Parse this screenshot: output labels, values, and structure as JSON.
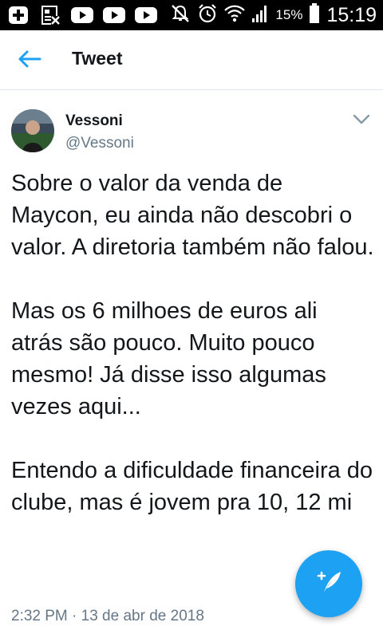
{
  "status_bar": {
    "left_icons": [
      "add-box-icon",
      "image-icon",
      "youtube-icon",
      "youtube-icon",
      "youtube-icon"
    ],
    "right_icons": [
      "notifications-off-icon",
      "alarm-icon",
      "wifi-icon",
      "signal-icon",
      "battery-icon"
    ],
    "battery": "15%",
    "time": "15:19"
  },
  "app_bar": {
    "back_icon": "arrow-left-icon",
    "title": "Tweet"
  },
  "tweet": {
    "author_name": "Vessoni",
    "author_handle": "@Vessoni",
    "paragraphs": [
      "Sobre o valor da venda de Maycon, eu ainda não descobri o valor. A diretoria também não falou.",
      "Mas os 6 milhoes de euros ali atrás são pouco. Muito pouco mesmo! Já disse isso algumas vezes aqui...",
      "Entendo a dificuldade financeira do clube, mas é jovem pra 10, 12 mi"
    ],
    "timestamp": "2:32 PM · 13 de abr de 2018"
  },
  "fab": {
    "icon": "compose-tweet-icon"
  },
  "colors": {
    "accent": "#1da1f2",
    "text_primary": "#14171a",
    "text_secondary": "#657786"
  }
}
